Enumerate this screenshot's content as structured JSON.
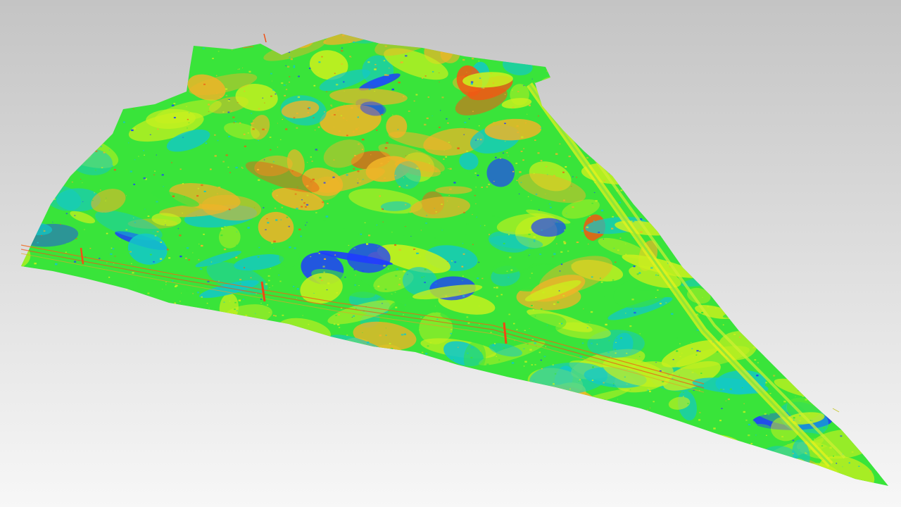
{
  "view": {
    "background_top": "#c4c4c4",
    "background_bottom": "#f7f7f7"
  },
  "point_cloud": {
    "colormap": "elevation-rainbow",
    "palette": {
      "low": "#1e3cff",
      "low_mid": "#12c8c8",
      "mid": "#39e43a",
      "mid_high": "#c8f01e",
      "high_mid": "#f0b428",
      "high": "#f05a14"
    },
    "features": [
      "terrain-surface",
      "highway-corridor",
      "power-line",
      "transmission-towers"
    ]
  }
}
